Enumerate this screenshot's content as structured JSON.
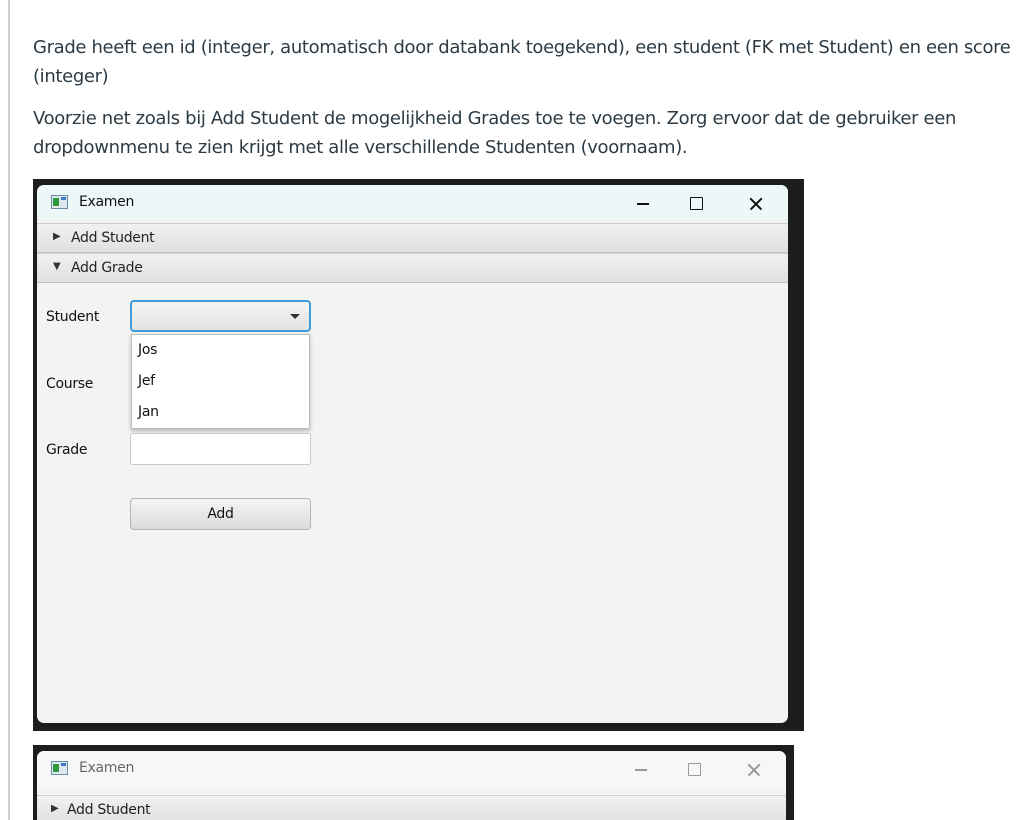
{
  "instructions": {
    "paragraph1": "Grade heeft een id (integer, automatisch door databank toegekend), een student (FK met Student) en een score (integer)",
    "paragraph2": "Voorzie net zoals bij Add Student de mogelijkheid Grades toe te voegen. Zorg ervoor dat de gebruiker een dropdownmenu te zien krijgt met alle verschillende Studenten (voornaam)."
  },
  "window1": {
    "title": "Examen",
    "icon": "app-window-icon",
    "controls": [
      "minimize-icon",
      "maximize-icon",
      "close-icon"
    ],
    "panes": [
      {
        "label": "Add Student",
        "expanded": false,
        "arrow": "▶"
      },
      {
        "label": "Add Grade",
        "expanded": true,
        "arrow": "▼"
      }
    ],
    "form": {
      "student_label": "Student",
      "course_label": "Course",
      "grade_label": "Grade",
      "student_selected": "",
      "student_options": [
        "Jos",
        "Jef",
        "Jan"
      ],
      "grade_value": "",
      "add_button": "Add"
    },
    "accent_color": "#3d9ed6"
  },
  "window2": {
    "title": "Examen",
    "panes": [
      {
        "label": "Add Student",
        "expanded": false,
        "arrow": "▶"
      }
    ]
  }
}
